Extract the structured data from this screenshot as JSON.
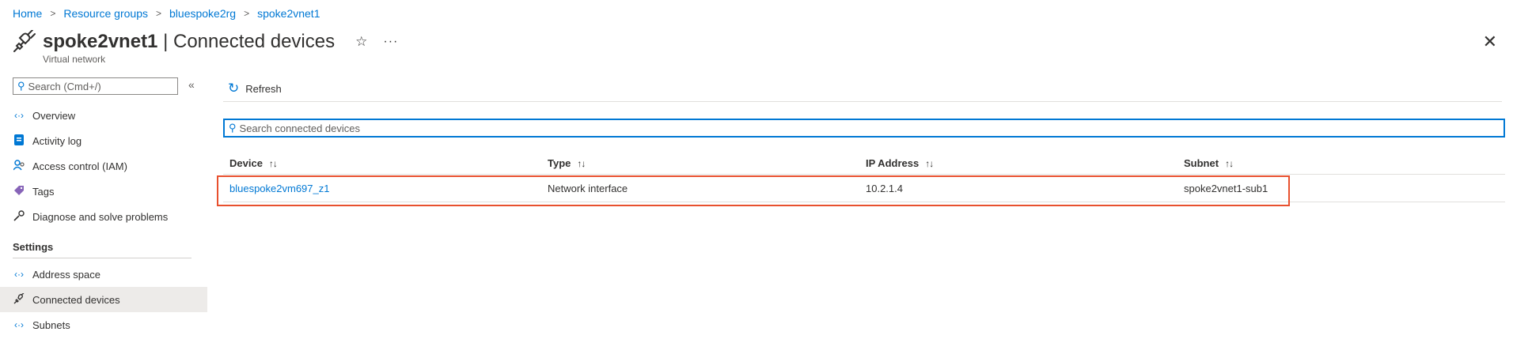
{
  "breadcrumb": [
    "Home",
    "Resource groups",
    "bluespoke2rg",
    "spoke2vnet1"
  ],
  "header": {
    "resource_name": "spoke2vnet1",
    "separator": "|",
    "blade_title": "Connected devices",
    "subtitle": "Virtual network",
    "favorite_glyph": "☆",
    "more_glyph": "···",
    "close_glyph": "✕"
  },
  "sidebar": {
    "search_placeholder": "Search (Cmd+/)",
    "collapse_glyph": "«",
    "items": [
      {
        "label": "Overview",
        "icon": "vnet-icon"
      },
      {
        "label": "Activity log",
        "icon": "activity-log-icon"
      },
      {
        "label": "Access control (IAM)",
        "icon": "iam-icon"
      },
      {
        "label": "Tags",
        "icon": "tag-icon"
      },
      {
        "label": "Diagnose and solve problems",
        "icon": "wrench-icon"
      }
    ],
    "settings_label": "Settings",
    "settings_items": [
      {
        "label": "Address space",
        "icon": "vnet-icon"
      },
      {
        "label": "Connected devices",
        "icon": "plug-icon",
        "active": true
      },
      {
        "label": "Subnets",
        "icon": "vnet-icon"
      }
    ]
  },
  "toolbar": {
    "refresh_label": "Refresh"
  },
  "search": {
    "placeholder": "Search connected devices"
  },
  "table": {
    "columns": [
      "Device",
      "Type",
      "IP Address",
      "Subnet"
    ],
    "sort_glyph": "↑↓",
    "rows": [
      {
        "device": "bluespoke2vm697_z1",
        "type": "Network interface",
        "ip": "10.2.1.4",
        "subnet": "spoke2vnet1-sub1"
      }
    ]
  },
  "colors": {
    "accent": "#0078d4",
    "highlight": "#e8502e",
    "active_bg": "#edebe9"
  }
}
